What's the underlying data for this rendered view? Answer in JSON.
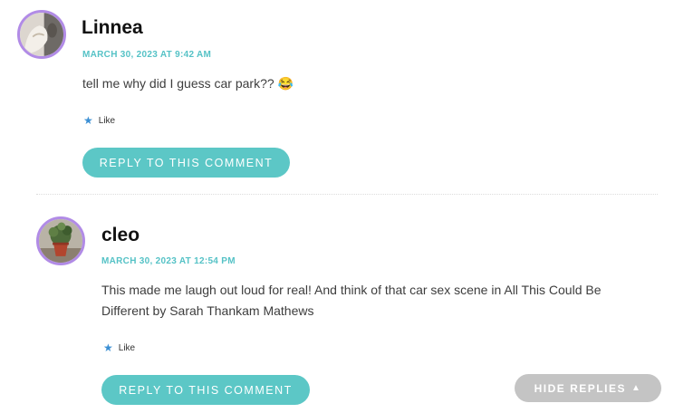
{
  "comments": [
    {
      "author": "Linnea",
      "timestamp": "MARCH 30, 2023 AT 9:42 AM",
      "text": "tell me why did I guess car park?? 😂",
      "like_label": "Like",
      "reply_label": "REPLY TO THIS COMMENT"
    },
    {
      "author": "cleo",
      "timestamp": "MARCH 30, 2023 AT 12:54 PM",
      "text_line1": "This made me laugh out loud for real! And think of that car sex scene in All This Could Be",
      "text_line2": "Different by Sarah Thankam Mathews",
      "like_label": "Like",
      "reply_label": "REPLY TO THIS COMMENT"
    }
  ],
  "hide_replies_label": "HIDE REPLIES",
  "colors": {
    "accent": "#5cc7c6",
    "timestamp": "#55c2c6",
    "avatar_border": "#b18be6",
    "like_star": "#3b8fd4",
    "hide_button": "#c4c4c4"
  },
  "icons": {
    "like": "star-icon",
    "hide": "triangle-up-icon"
  }
}
